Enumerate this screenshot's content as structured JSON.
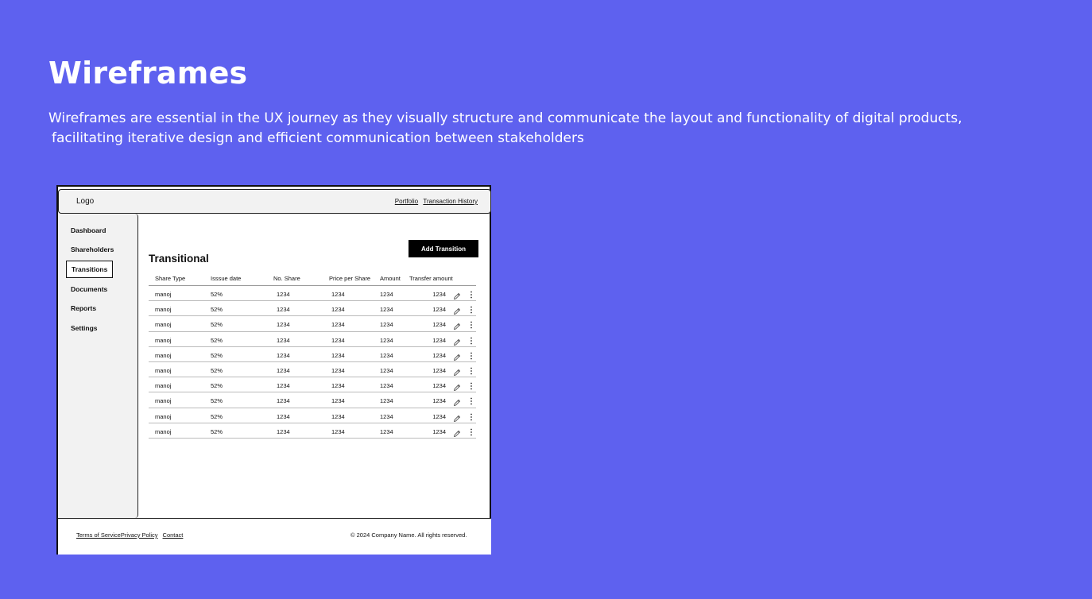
{
  "heading": "Wireframes",
  "description_line1": "Wireframes are essential in the UX journey as they visually structure and communicate the layout and functionality of digital products,",
  "description_line2": "facilitating iterative design and efficient communication between stakeholders",
  "colors": {
    "background": "#5e61ef",
    "text": "#ffffff",
    "button": "#000000"
  },
  "wireframe": {
    "logo": "Logo",
    "header_links": [
      "Portfolio",
      "Transaction History"
    ],
    "sidebar": [
      "Dashboard",
      "Shareholders",
      "Transitions",
      "Documents",
      "Reports",
      "Settings"
    ],
    "sidebar_active": "Transitions",
    "title": "Transitional",
    "add_button": "Add Transition",
    "columns": [
      "Share Type",
      "Isssue date",
      "No. Share",
      "Price per Share",
      "Amount",
      "Transfer amount"
    ],
    "rows": [
      [
        "manoj",
        "52%",
        "1234",
        "1234",
        "1234",
        "1234"
      ],
      [
        "manoj",
        "52%",
        "1234",
        "1234",
        "1234",
        "1234"
      ],
      [
        "manoj",
        "52%",
        "1234",
        "1234",
        "1234",
        "1234"
      ],
      [
        "manoj",
        "52%",
        "1234",
        "1234",
        "1234",
        "1234"
      ],
      [
        "manoj",
        "52%",
        "1234",
        "1234",
        "1234",
        "1234"
      ],
      [
        "manoj",
        "52%",
        "1234",
        "1234",
        "1234",
        "1234"
      ],
      [
        "manoj",
        "52%",
        "1234",
        "1234",
        "1234",
        "1234"
      ],
      [
        "manoj",
        "52%",
        "1234",
        "1234",
        "1234",
        "1234"
      ],
      [
        "manoj",
        "52%",
        "1234",
        "1234",
        "1234",
        "1234"
      ],
      [
        "manoj",
        "52%",
        "1234",
        "1234",
        "1234",
        "1234"
      ]
    ],
    "row_icons": [
      "pencil-icon",
      "more-vertical-icon"
    ],
    "footer_links": [
      "Terms of Service",
      "Privacy Policy",
      "Contact"
    ],
    "copyright": "© 2024 Company Name. All rights reserved."
  }
}
